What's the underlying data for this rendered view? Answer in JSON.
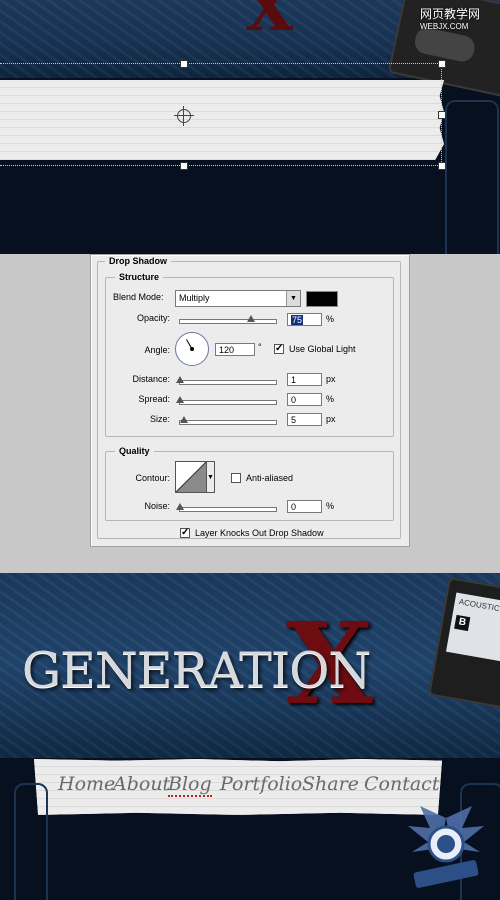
{
  "watermark": {
    "line1": "网页教学网",
    "line2": "WEBJX.COM"
  },
  "dialog": {
    "title": "Drop Shadow",
    "structure": {
      "title": "Structure",
      "blend_mode_label": "Blend Mode:",
      "blend_mode_value": "Multiply",
      "shadow_color": "#000000",
      "opacity_label": "Opacity:",
      "opacity_value": "75",
      "opacity_unit": "%",
      "opacity_level": 0.75,
      "angle_label": "Angle:",
      "angle_value": "120",
      "angle_unit": "°",
      "use_global_light_label": "Use Global Light",
      "use_global_light_checked": true,
      "distance_label": "Distance:",
      "distance_value": "1",
      "distance_unit": "px",
      "spread_label": "Spread:",
      "spread_value": "0",
      "spread_unit": "%",
      "size_label": "Size:",
      "size_value": "5",
      "size_unit": "px"
    },
    "quality": {
      "title": "Quality",
      "contour_label": "Contour:",
      "anti_aliased_label": "Anti-aliased",
      "anti_aliased_checked": false,
      "noise_label": "Noise:",
      "noise_value": "0",
      "noise_unit": "%"
    },
    "layer_knocks_out_label": "Layer Knocks Out Drop Shadow",
    "layer_knocks_out_checked": true
  },
  "site": {
    "logo": "GENERATION",
    "logo_x": "X",
    "tape_label": "ACOUSTIC",
    "tape_side": "B",
    "nav": [
      "Home",
      "About",
      "Blog",
      "Portfolio",
      "Share",
      "Contact"
    ]
  }
}
